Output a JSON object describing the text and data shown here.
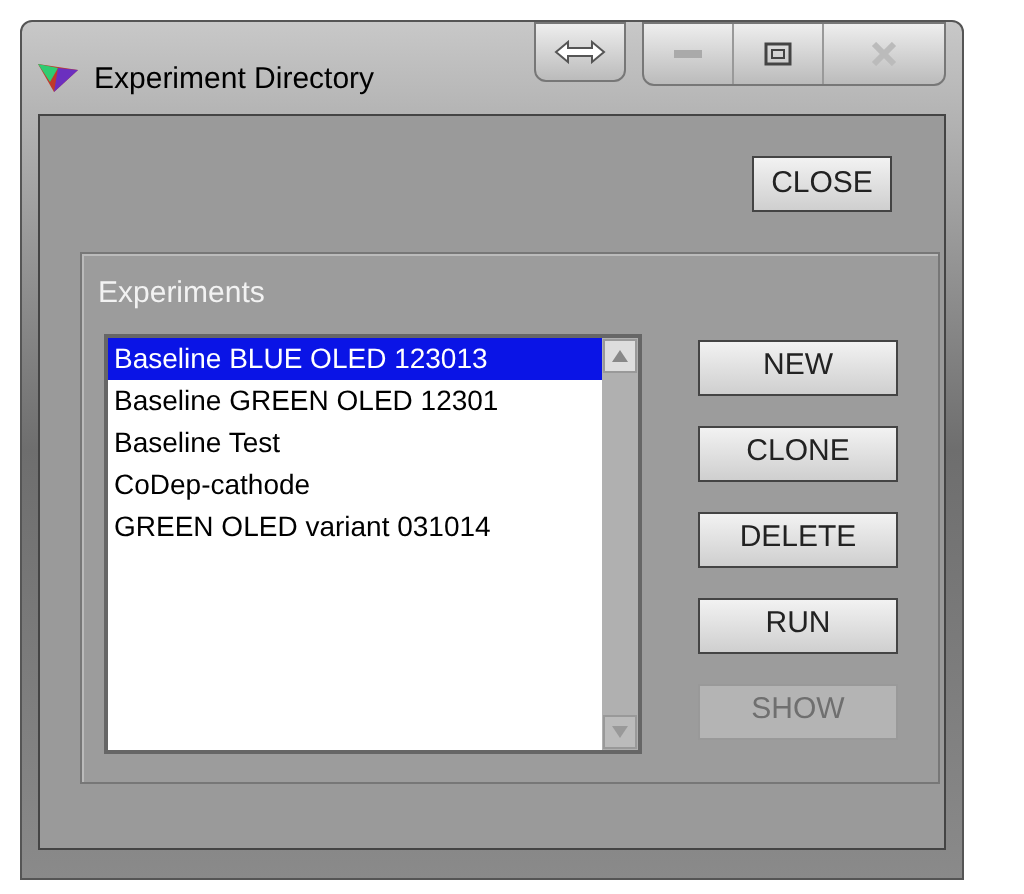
{
  "window": {
    "title": "Experiment Directory"
  },
  "close_button": {
    "label": "CLOSE"
  },
  "group": {
    "label": "Experiments"
  },
  "experiments": [
    {
      "name": "Baseline BLUE OLED 123013",
      "selected": true
    },
    {
      "name": "Baseline GREEN OLED 12301",
      "selected": false
    },
    {
      "name": "Baseline Test",
      "selected": false
    },
    {
      "name": "CoDep-cathode",
      "selected": false
    },
    {
      "name": "GREEN OLED variant 031014",
      "selected": false
    }
  ],
  "buttons": [
    {
      "label": "NEW",
      "disabled": false
    },
    {
      "label": "CLONE",
      "disabled": false
    },
    {
      "label": "DELETE",
      "disabled": false
    },
    {
      "label": "RUN",
      "disabled": false
    },
    {
      "label": "SHOW",
      "disabled": true
    }
  ]
}
